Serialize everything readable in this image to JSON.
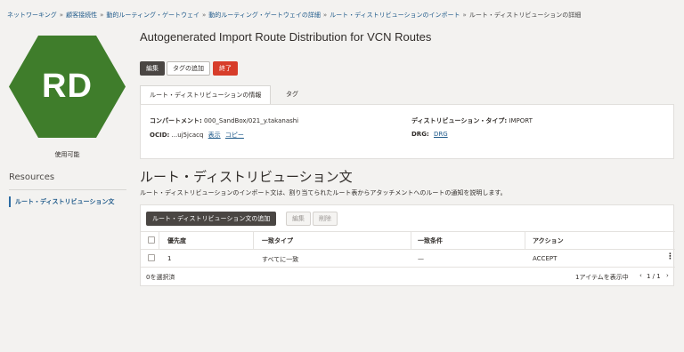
{
  "breadcrumb": [
    "ネットワーキング",
    "顧客接続性",
    "動的ルーティング・ゲートウェイ",
    "動的ルーティング・ゲートウェイの詳細",
    "ルート・ディストリビューションのインポート"
  ],
  "breadcrumb_current": "ルート・ディストリビューションの詳細",
  "avatar": {
    "initials": "RD",
    "color": "#3f7d2b"
  },
  "state": "使用可能",
  "resources": {
    "heading": "Resources",
    "item": "ルート・ディストリビューション文"
  },
  "page_title": "Autogenerated Import Route Distribution for VCN Routes",
  "actions": {
    "edit": "編集",
    "add_tags": "タグの追加",
    "terminate": "終了"
  },
  "tabs": {
    "info": "ルート・ディストリビューションの情報",
    "tags": "タグ"
  },
  "info": {
    "compartment_label": "コンパートメント:",
    "compartment_value": "000_SandBox/021_y.takanashi",
    "ocid_label": "OCID:",
    "ocid_value": "...uj5jcacq",
    "show_link": "表示",
    "copy_link": "コピー",
    "type_label": "ディストリビューション・タイプ:",
    "type_value": "IMPORT",
    "drg_label": "DRG:",
    "drg_link": "DRG"
  },
  "section": {
    "title": "ルート・ディストリビューション文",
    "description": "ルート・ディストリビューションのインポート文は、割り当てられたルート表からアタッチメントへのルートの通知を説明します。"
  },
  "table_toolbar": {
    "add": "ルート・ディストリビューション文の追加",
    "edit": "編集",
    "delete": "削除"
  },
  "table": {
    "columns": [
      "優先度",
      "一致タイプ",
      "一致条件",
      "アクション"
    ],
    "rows": [
      {
        "priority": "1",
        "match_type": "すべてに一致",
        "match_criteria": "—",
        "action": "ACCEPT"
      }
    ]
  },
  "footer": {
    "selected": "0を選択済",
    "showing": "1アイテムを表示中",
    "page": "1 / 1"
  },
  "colors": {
    "accent": "#1f5a8a",
    "terminate": "#d73d2a",
    "hex": "#3f7d2b"
  }
}
